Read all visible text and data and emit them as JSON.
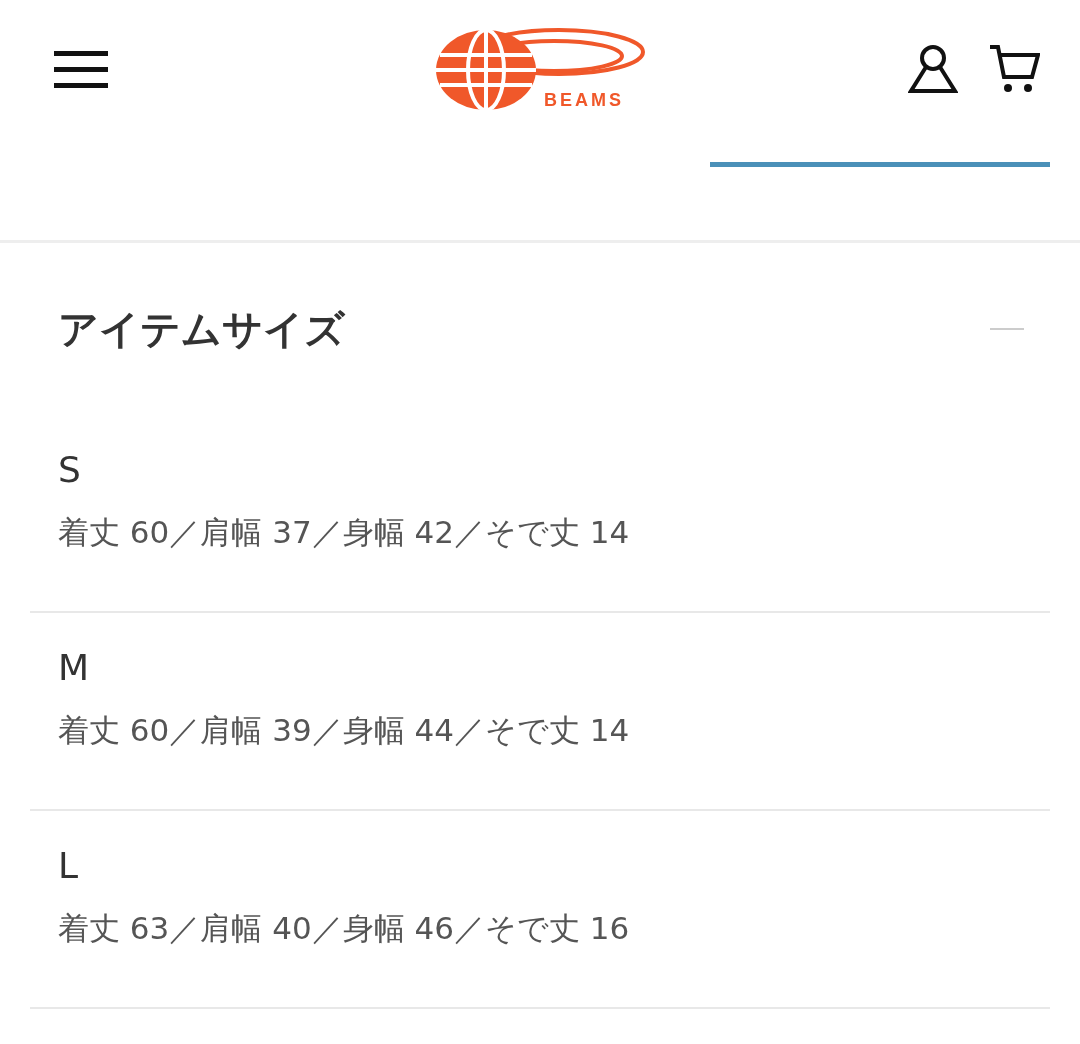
{
  "header": {
    "logo_text": "BEAMS"
  },
  "section": {
    "title": "アイテムサイズ",
    "expanded": true,
    "sizes": [
      {
        "label": "S",
        "details": "着丈 60／肩幅 37／身幅 42／そで丈 14"
      },
      {
        "label": "M",
        "details": "着丈 60／肩幅 39／身幅 44／そで丈 14"
      },
      {
        "label": "L",
        "details": "着丈 63／肩幅 40／身幅 46／そで丈 16"
      }
    ]
  }
}
